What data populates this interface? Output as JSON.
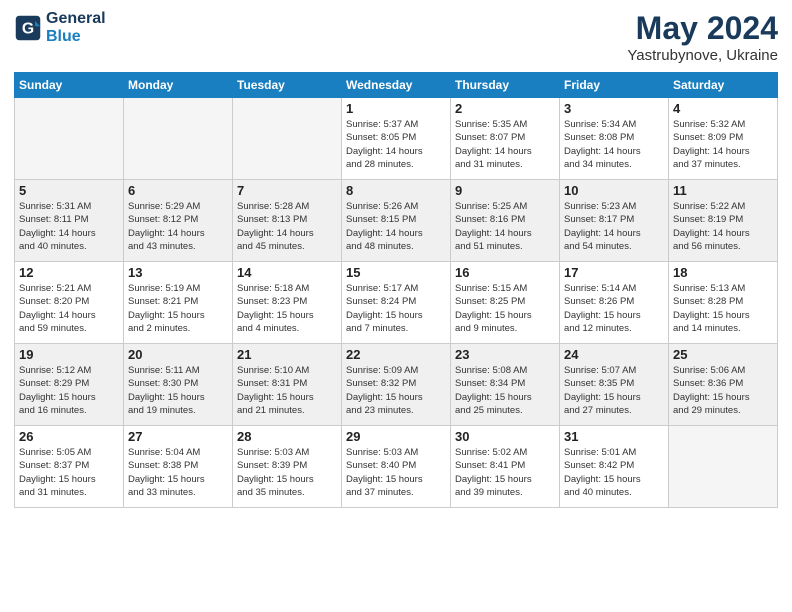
{
  "header": {
    "logo_line1": "General",
    "logo_line2": "Blue",
    "month": "May 2024",
    "location": "Yastrubynove, Ukraine"
  },
  "weekdays": [
    "Sunday",
    "Monday",
    "Tuesday",
    "Wednesday",
    "Thursday",
    "Friday",
    "Saturday"
  ],
  "weeks": [
    [
      {
        "num": "",
        "info": ""
      },
      {
        "num": "",
        "info": ""
      },
      {
        "num": "",
        "info": ""
      },
      {
        "num": "1",
        "info": "Sunrise: 5:37 AM\nSunset: 8:05 PM\nDaylight: 14 hours\nand 28 minutes."
      },
      {
        "num": "2",
        "info": "Sunrise: 5:35 AM\nSunset: 8:07 PM\nDaylight: 14 hours\nand 31 minutes."
      },
      {
        "num": "3",
        "info": "Sunrise: 5:34 AM\nSunset: 8:08 PM\nDaylight: 14 hours\nand 34 minutes."
      },
      {
        "num": "4",
        "info": "Sunrise: 5:32 AM\nSunset: 8:09 PM\nDaylight: 14 hours\nand 37 minutes."
      }
    ],
    [
      {
        "num": "5",
        "info": "Sunrise: 5:31 AM\nSunset: 8:11 PM\nDaylight: 14 hours\nand 40 minutes."
      },
      {
        "num": "6",
        "info": "Sunrise: 5:29 AM\nSunset: 8:12 PM\nDaylight: 14 hours\nand 43 minutes."
      },
      {
        "num": "7",
        "info": "Sunrise: 5:28 AM\nSunset: 8:13 PM\nDaylight: 14 hours\nand 45 minutes."
      },
      {
        "num": "8",
        "info": "Sunrise: 5:26 AM\nSunset: 8:15 PM\nDaylight: 14 hours\nand 48 minutes."
      },
      {
        "num": "9",
        "info": "Sunrise: 5:25 AM\nSunset: 8:16 PM\nDaylight: 14 hours\nand 51 minutes."
      },
      {
        "num": "10",
        "info": "Sunrise: 5:23 AM\nSunset: 8:17 PM\nDaylight: 14 hours\nand 54 minutes."
      },
      {
        "num": "11",
        "info": "Sunrise: 5:22 AM\nSunset: 8:19 PM\nDaylight: 14 hours\nand 56 minutes."
      }
    ],
    [
      {
        "num": "12",
        "info": "Sunrise: 5:21 AM\nSunset: 8:20 PM\nDaylight: 14 hours\nand 59 minutes."
      },
      {
        "num": "13",
        "info": "Sunrise: 5:19 AM\nSunset: 8:21 PM\nDaylight: 15 hours\nand 2 minutes."
      },
      {
        "num": "14",
        "info": "Sunrise: 5:18 AM\nSunset: 8:23 PM\nDaylight: 15 hours\nand 4 minutes."
      },
      {
        "num": "15",
        "info": "Sunrise: 5:17 AM\nSunset: 8:24 PM\nDaylight: 15 hours\nand 7 minutes."
      },
      {
        "num": "16",
        "info": "Sunrise: 5:15 AM\nSunset: 8:25 PM\nDaylight: 15 hours\nand 9 minutes."
      },
      {
        "num": "17",
        "info": "Sunrise: 5:14 AM\nSunset: 8:26 PM\nDaylight: 15 hours\nand 12 minutes."
      },
      {
        "num": "18",
        "info": "Sunrise: 5:13 AM\nSunset: 8:28 PM\nDaylight: 15 hours\nand 14 minutes."
      }
    ],
    [
      {
        "num": "19",
        "info": "Sunrise: 5:12 AM\nSunset: 8:29 PM\nDaylight: 15 hours\nand 16 minutes."
      },
      {
        "num": "20",
        "info": "Sunrise: 5:11 AM\nSunset: 8:30 PM\nDaylight: 15 hours\nand 19 minutes."
      },
      {
        "num": "21",
        "info": "Sunrise: 5:10 AM\nSunset: 8:31 PM\nDaylight: 15 hours\nand 21 minutes."
      },
      {
        "num": "22",
        "info": "Sunrise: 5:09 AM\nSunset: 8:32 PM\nDaylight: 15 hours\nand 23 minutes."
      },
      {
        "num": "23",
        "info": "Sunrise: 5:08 AM\nSunset: 8:34 PM\nDaylight: 15 hours\nand 25 minutes."
      },
      {
        "num": "24",
        "info": "Sunrise: 5:07 AM\nSunset: 8:35 PM\nDaylight: 15 hours\nand 27 minutes."
      },
      {
        "num": "25",
        "info": "Sunrise: 5:06 AM\nSunset: 8:36 PM\nDaylight: 15 hours\nand 29 minutes."
      }
    ],
    [
      {
        "num": "26",
        "info": "Sunrise: 5:05 AM\nSunset: 8:37 PM\nDaylight: 15 hours\nand 31 minutes."
      },
      {
        "num": "27",
        "info": "Sunrise: 5:04 AM\nSunset: 8:38 PM\nDaylight: 15 hours\nand 33 minutes."
      },
      {
        "num": "28",
        "info": "Sunrise: 5:03 AM\nSunset: 8:39 PM\nDaylight: 15 hours\nand 35 minutes."
      },
      {
        "num": "29",
        "info": "Sunrise: 5:03 AM\nSunset: 8:40 PM\nDaylight: 15 hours\nand 37 minutes."
      },
      {
        "num": "30",
        "info": "Sunrise: 5:02 AM\nSunset: 8:41 PM\nDaylight: 15 hours\nand 39 minutes."
      },
      {
        "num": "31",
        "info": "Sunrise: 5:01 AM\nSunset: 8:42 PM\nDaylight: 15 hours\nand 40 minutes."
      },
      {
        "num": "",
        "info": ""
      }
    ]
  ],
  "gray_rows": [
    1,
    3
  ]
}
